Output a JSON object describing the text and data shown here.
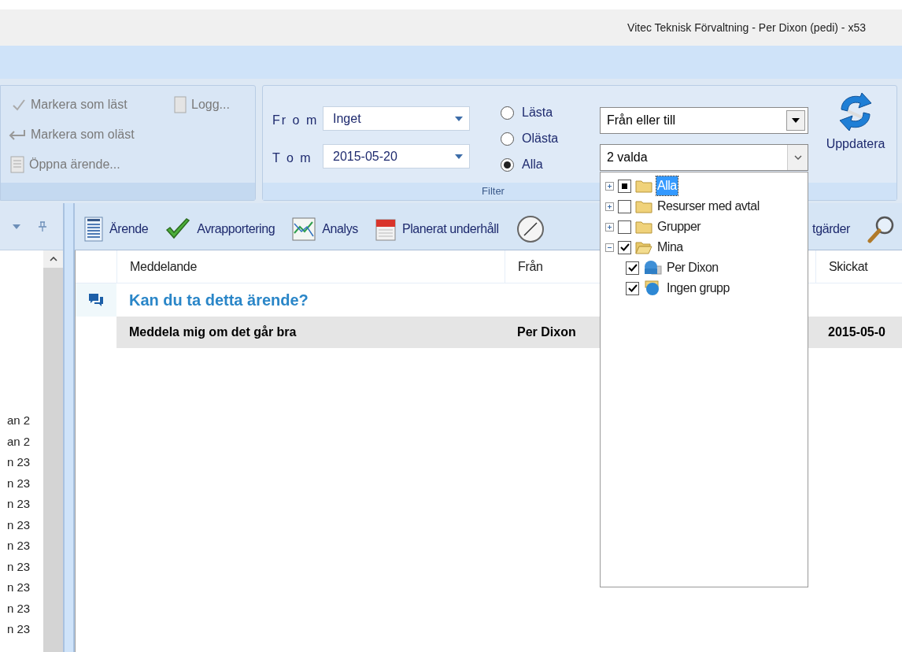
{
  "window": {
    "title": "Vitec Teknisk Förvaltning - Per Dixon (pedi) - x53"
  },
  "ribbon": {
    "actions": [
      {
        "label": "Markera som läst"
      },
      {
        "label": "Logg..."
      },
      {
        "label": "Markera som oläst"
      },
      {
        "label": "Öppna ärende..."
      }
    ],
    "filter": {
      "group_label": "Filter",
      "from_label": "Fr o m",
      "from_value": "Inget",
      "to_label": "T o m",
      "to_value": "2015-05-20",
      "radios": [
        {
          "label": "Lästa",
          "selected": false
        },
        {
          "label": "Olästa",
          "selected": false
        },
        {
          "label": "Alla",
          "selected": true
        }
      ],
      "direction_value": "Från eller till",
      "recipients_value": "2 valda"
    },
    "refresh_label": "Uppdatera"
  },
  "left_pane": {
    "items": [
      "an 2",
      "an 2",
      "n 23",
      "n 23",
      "n 23",
      "n 23",
      "n 23",
      "n 23",
      "n 23",
      "n 23",
      "n 23"
    ]
  },
  "toolbar": [
    {
      "label": "Ärende"
    },
    {
      "label": "Avrapportering"
    },
    {
      "label": "Analys"
    },
    {
      "label": "Planerat underhåll"
    },
    {
      "label": "tgärder"
    }
  ],
  "grid": {
    "columns": [
      "Meddelande",
      "Från",
      "Skickat"
    ],
    "groups": [
      {
        "title": "Kan du ta detta ärende?",
        "rows": [
          {
            "message": "Meddela mig om det går bra",
            "from": "Per Dixon",
            "sent": "2015-05-0",
            "selected": true
          }
        ]
      }
    ]
  },
  "recipient_tree": [
    {
      "label": "Alla",
      "kind": "folder",
      "partial": true,
      "expanded": false,
      "selected": true
    },
    {
      "label": "Resurser med avtal",
      "kind": "folder",
      "checked": false,
      "expanded": false,
      "selected": false
    },
    {
      "label": "Grupper",
      "kind": "folder",
      "checked": false,
      "expanded": false,
      "selected": false
    },
    {
      "label": "Mina",
      "kind": "open-folder",
      "checked": true,
      "expanded": true,
      "selected": false,
      "children": [
        {
          "label": "Per Dixon",
          "kind": "user",
          "checked": true,
          "selected": false
        },
        {
          "label": "Ingen grupp",
          "kind": "group",
          "checked": true,
          "selected": false
        }
      ]
    }
  ]
}
